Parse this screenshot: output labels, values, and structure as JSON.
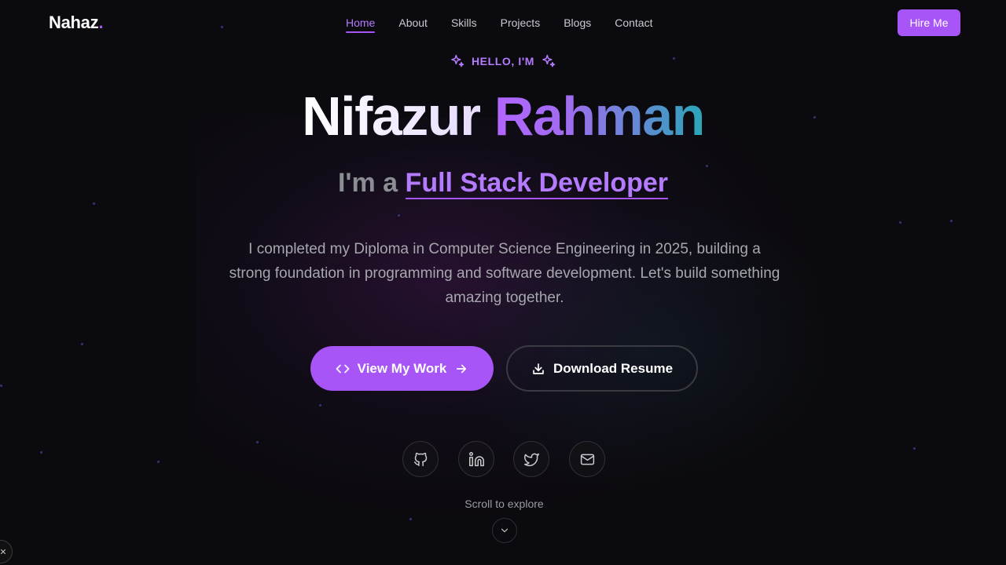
{
  "header": {
    "logo_text": "Nahaz",
    "logo_dot": ".",
    "nav": [
      {
        "label": "Home",
        "active": true
      },
      {
        "label": "About"
      },
      {
        "label": "Skills"
      },
      {
        "label": "Projects"
      },
      {
        "label": "Blogs"
      },
      {
        "label": "Contact"
      }
    ],
    "hire_label": "Hire Me"
  },
  "hero": {
    "greeting": "HELLO, I'M",
    "greeting_icon": "sparkles-icon",
    "first_name": "Nifazur",
    "last_name": "Rahman",
    "role_prefix": "I'm a",
    "role": "Full Stack Developer",
    "description": "I completed my Diploma in Computer Science Engineering in 2025, building a strong foundation in programming and software development. Let's build something amazing together.",
    "primary_button": {
      "label": "View My Work",
      "icon_left": "code-icon",
      "icon_right": "arrow-right-icon"
    },
    "secondary_button": {
      "label": "Download Resume",
      "icon": "download-icon"
    }
  },
  "social": [
    {
      "icon": "github-icon"
    },
    {
      "icon": "linkedin-icon"
    },
    {
      "icon": "twitter-icon"
    },
    {
      "icon": "mail-icon"
    }
  ],
  "scroll": {
    "label": "Scroll to explore",
    "icon": "chevron-down-icon"
  },
  "colors": {
    "background": "#0b0a0e",
    "accent": "#a855f7",
    "accent_text": "#b57bff",
    "teal": "#2aa6b8"
  }
}
